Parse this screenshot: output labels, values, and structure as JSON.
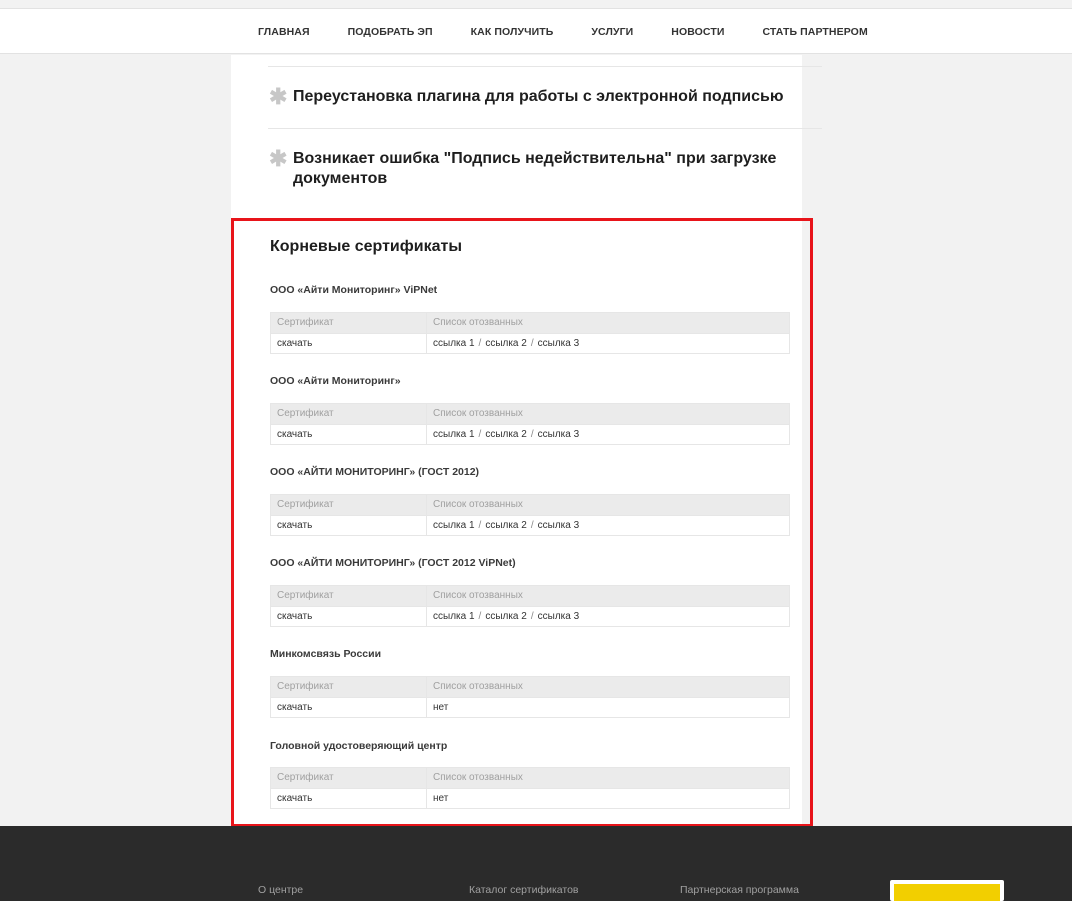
{
  "nav": {
    "items": [
      "ГЛАВНАЯ",
      "ПОДОБРАТЬ ЭП",
      "КАК ПОЛУЧИТЬ",
      "УСЛУГИ",
      "НОВОСТИ",
      "СТАТЬ ПАРТНЕРОМ"
    ]
  },
  "faq": {
    "items": [
      {
        "icon": "asterisk-icon",
        "question": "Переустановка плагина для работы с электронной подписью"
      },
      {
        "icon": "asterisk-icon",
        "question": "Возникает ошибка \"Подпись недействительна\" при загрузке документов"
      }
    ]
  },
  "certificates": {
    "title": "Корневые сертификаты",
    "col_cert": "Сертификат",
    "col_crl": "Список отозванных",
    "groups": [
      {
        "name": "ООО «Айти Мониторинг» ViPNet",
        "download": "скачать",
        "links": [
          "ссылка 1",
          "ссылка 2",
          "ссылка 3"
        ],
        "none": ""
      },
      {
        "name": "ООО «Айти Мониторинг»",
        "download": "скачать",
        "links": [
          "ссылка 1",
          "ссылка 2",
          "ссылка 3"
        ],
        "none": ""
      },
      {
        "name": "ООО «АЙТИ МОНИТОРИНГ» (ГОСТ 2012)",
        "download": "скачать",
        "links": [
          "ссылка 1",
          "ссылка 2",
          "ссылка 3"
        ],
        "none": ""
      },
      {
        "name": "ООО «АЙТИ МОНИТОРИНГ» (ГОСТ 2012 ViPNet)",
        "download": "скачать",
        "links": [
          "ссылка 1",
          "ссылка 2",
          "ссылка 3"
        ],
        "none": ""
      },
      {
        "name": "Минкомсвязь России",
        "download": "скачать",
        "links": [],
        "none": "нет"
      },
      {
        "name": "Головной удостоверяющий центр",
        "download": "скачать",
        "links": [],
        "none": "нет"
      }
    ],
    "separator": "/"
  },
  "footer": {
    "links": [
      "О центре",
      "Каталог сертификатов",
      "Партнерская программа"
    ]
  },
  "colors": {
    "highlight_border": "#e8141a",
    "footer_bg": "#2b2b2b",
    "badge_accent": "#f2cf00"
  }
}
